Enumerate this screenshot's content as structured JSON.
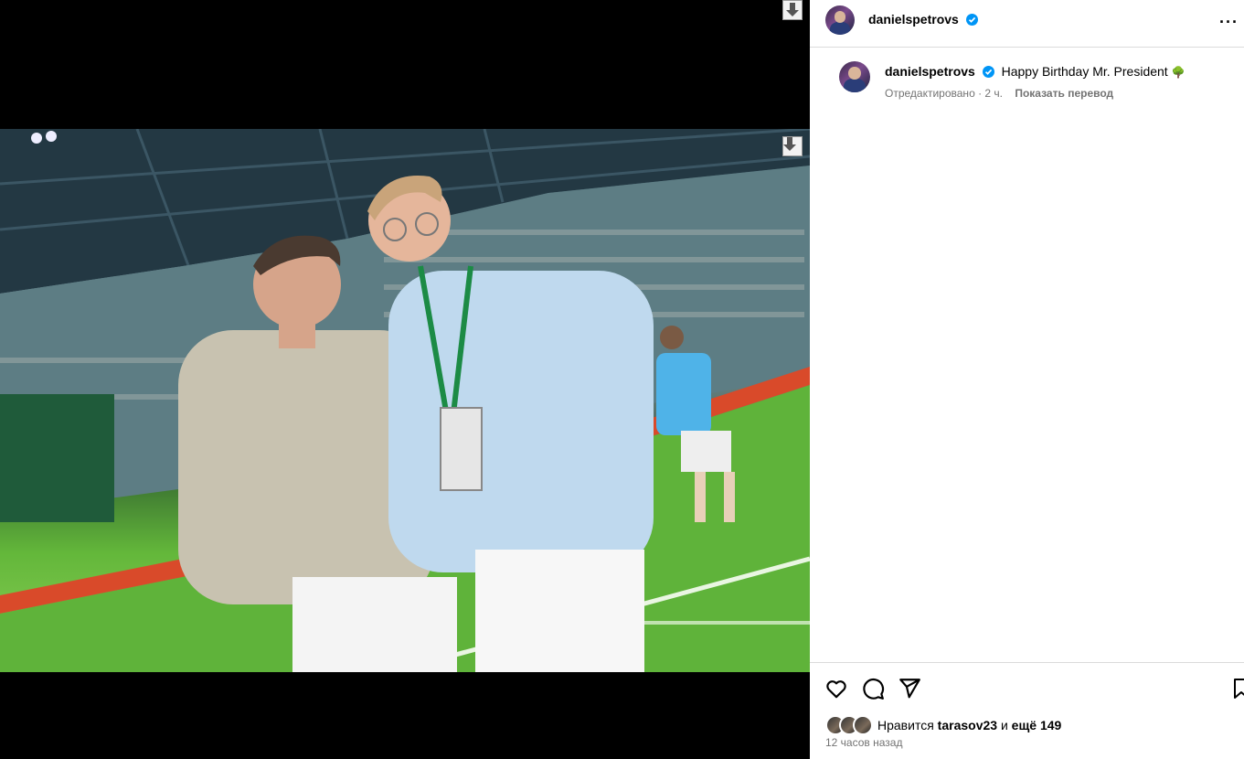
{
  "post": {
    "username": "danielspetrovs",
    "caption_text": "Happy Birthday Mr. President",
    "caption_emoji": "🌳",
    "meta_edited": "Отредактировано · 2 ч.",
    "translate_label": "Показать перевод",
    "likes_prefix": "Нравится",
    "likes_user": "tarasov23",
    "likes_connector": "и",
    "likes_rest": "ещё 149",
    "timestamp": "12 часов назад",
    "more_label": "···"
  },
  "colors": {
    "verified": "#0095f6",
    "muted": "#737373",
    "border": "#dbdbdb"
  },
  "icons": {
    "like": "heart-icon",
    "comment": "comment-icon",
    "share": "share-icon",
    "save": "bookmark-icon",
    "download": "download-arrow-icon"
  }
}
